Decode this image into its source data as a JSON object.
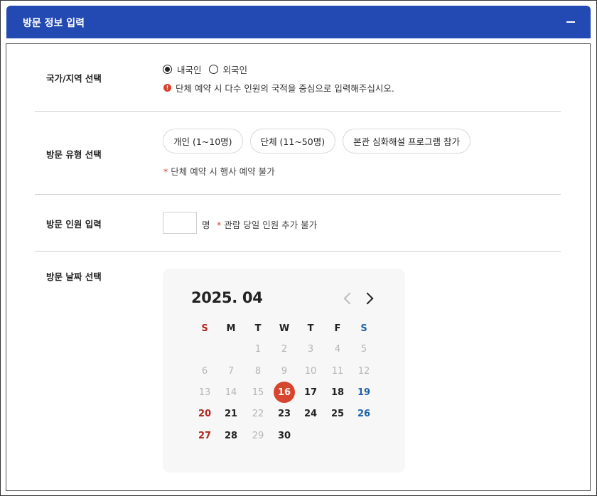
{
  "header": {
    "title": "방문 정보 입력",
    "collapse_icon": "minus-icon"
  },
  "nationality": {
    "label": "국가/지역 선택",
    "options": [
      "내국인",
      "외국인"
    ],
    "selected": "내국인",
    "info_text": "단체 예약 시 다수 인원의 국적을 중심으로 입력해주십시오."
  },
  "visit_type": {
    "label": "방문 유형 선택",
    "options": [
      "개인 (1~10명)",
      "단체 (11~50명)",
      "본관 심화해설 프로그램 참가"
    ],
    "note": "단체 예약 시 행사 예약 불가"
  },
  "visitors": {
    "label": "방문 인원 입력",
    "value": "",
    "unit": "명",
    "note": "관람 당일 인원 추가 불가"
  },
  "date": {
    "label": "방문 날짜 선택",
    "calendar": {
      "title": "2025. 04",
      "weekdays": [
        "S",
        "M",
        "T",
        "W",
        "T",
        "F",
        "S"
      ],
      "selected_day": "16",
      "weeks": [
        [
          {
            "d": "",
            "s": "empty"
          },
          {
            "d": "",
            "s": "empty"
          },
          {
            "d": "1",
            "s": "disabled"
          },
          {
            "d": "2",
            "s": "disabled"
          },
          {
            "d": "3",
            "s": "disabled"
          },
          {
            "d": "4",
            "s": "disabled"
          },
          {
            "d": "5",
            "s": "disabled"
          }
        ],
        [
          {
            "d": "6",
            "s": "disabled"
          },
          {
            "d": "7",
            "s": "disabled"
          },
          {
            "d": "8",
            "s": "disabled"
          },
          {
            "d": "9",
            "s": "disabled"
          },
          {
            "d": "10",
            "s": "disabled"
          },
          {
            "d": "11",
            "s": "disabled"
          },
          {
            "d": "12",
            "s": "disabled"
          }
        ],
        [
          {
            "d": "13",
            "s": "disabled"
          },
          {
            "d": "14",
            "s": "disabled"
          },
          {
            "d": "15",
            "s": "disabled"
          },
          {
            "d": "16",
            "s": "selected"
          },
          {
            "d": "17",
            "s": "available"
          },
          {
            "d": "18",
            "s": "available"
          },
          {
            "d": "19",
            "s": "saturday"
          }
        ],
        [
          {
            "d": "20",
            "s": "sunday"
          },
          {
            "d": "21",
            "s": "available"
          },
          {
            "d": "22",
            "s": "disabled"
          },
          {
            "d": "23",
            "s": "available"
          },
          {
            "d": "24",
            "s": "available"
          },
          {
            "d": "25",
            "s": "available"
          },
          {
            "d": "26",
            "s": "saturday"
          }
        ],
        [
          {
            "d": "27",
            "s": "sunday"
          },
          {
            "d": "28",
            "s": "available"
          },
          {
            "d": "29",
            "s": "disabled"
          },
          {
            "d": "30",
            "s": "available"
          },
          {
            "d": "",
            "s": "empty"
          },
          {
            "d": "",
            "s": "empty"
          },
          {
            "d": "",
            "s": "empty"
          }
        ]
      ]
    }
  },
  "colors": {
    "header_bg": "#2349b3",
    "accent_red": "#d6412c",
    "sunday": "#b0261f",
    "saturday": "#1f63a8",
    "disabled": "#b5b5b5"
  }
}
